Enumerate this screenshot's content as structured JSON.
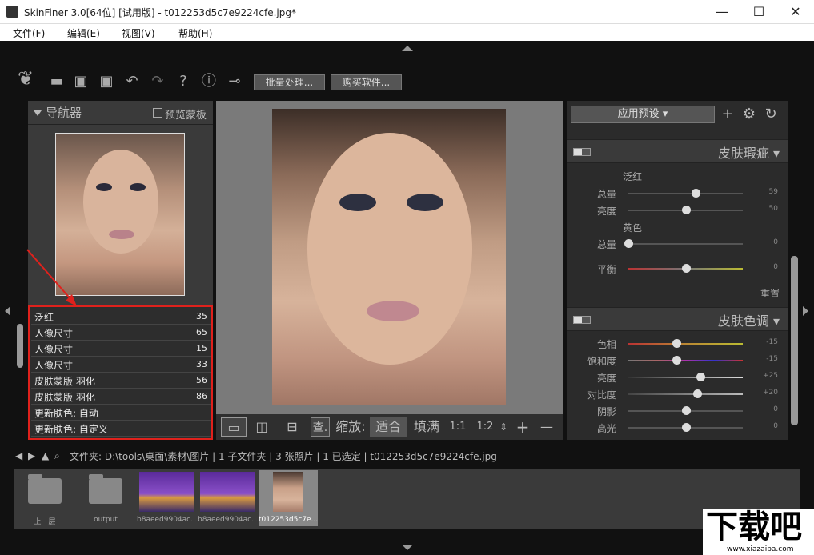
{
  "window": {
    "title": "SkinFiner 3.0[64位] [试用版] - t012253d5c7e9224cfe.jpg*",
    "minimize": "—",
    "maximize": "☐",
    "close": "✕"
  },
  "menu": {
    "file": "文件(F)",
    "edit": "编辑(E)",
    "view": "视图(V)",
    "help": "帮助(H)"
  },
  "toolbar": {
    "batch_label": "批量处理...",
    "buy_label": "购买软件..."
  },
  "navigator": {
    "title": "导航器",
    "preview_mask": "预览蒙板"
  },
  "history": [
    {
      "name": "泛红",
      "value": "35"
    },
    {
      "name": "人像尺寸",
      "value": "65"
    },
    {
      "name": "人像尺寸",
      "value": "15"
    },
    {
      "name": "人像尺寸",
      "value": "33"
    },
    {
      "name": "皮肤蒙版 羽化",
      "value": "56"
    },
    {
      "name": "皮肤蒙版 羽化",
      "value": "86"
    },
    {
      "name": "更新肤色: 自动",
      "value": ""
    },
    {
      "name": "更新肤色: 自定义",
      "value": ""
    }
  ],
  "viewbar": {
    "query": "查.",
    "zoom_label": "缩放:",
    "fit": "适合",
    "fill": "填满",
    "ratio_1_1": "1:1",
    "ratio_1_2": "1:2",
    "plus": "+",
    "minus": "—"
  },
  "right": {
    "preset": "应用预设",
    "blemish": {
      "title": "皮肤瑕疵",
      "redness": "泛红",
      "yellow": "黄色",
      "rows": [
        {
          "label": "总量",
          "value": "59",
          "level": 0.59
        },
        {
          "label": "亮度",
          "value": "50",
          "level": 0.5
        },
        {
          "label": "总量",
          "value": "0",
          "level": 0
        },
        {
          "label": "平衡",
          "value": "0",
          "level": 0.5
        }
      ],
      "reset": "重置"
    },
    "tone": {
      "title": "皮肤色调",
      "rows": [
        {
          "label": "色相",
          "value": "-15",
          "level": 0.42
        },
        {
          "label": "饱和度",
          "value": "-15",
          "level": 0.42
        },
        {
          "label": "亮度",
          "value": "+25",
          "level": 0.63
        },
        {
          "label": "对比度",
          "value": "+20",
          "level": 0.6
        },
        {
          "label": "阴影",
          "value": "0",
          "level": 0.5
        },
        {
          "label": "高光",
          "value": "0",
          "level": 0.5
        }
      ]
    }
  },
  "pathbar": {
    "text": "文件夹:  D:\\tools\\桌面\\素材\\图片 | 1 子文件夹 | 3 张照片 | 1 已选定 | t012253d5c7e9224cfe.jpg"
  },
  "thumbs": [
    {
      "caption": "上一层"
    },
    {
      "caption": "output"
    },
    {
      "caption": "b8aeed9904ac..."
    },
    {
      "caption": "b8aeed9904ac..."
    },
    {
      "caption": "t012253d5c7e..."
    }
  ],
  "watermark": {
    "big": "下载吧",
    "small": "www.xiazaiba.com"
  }
}
